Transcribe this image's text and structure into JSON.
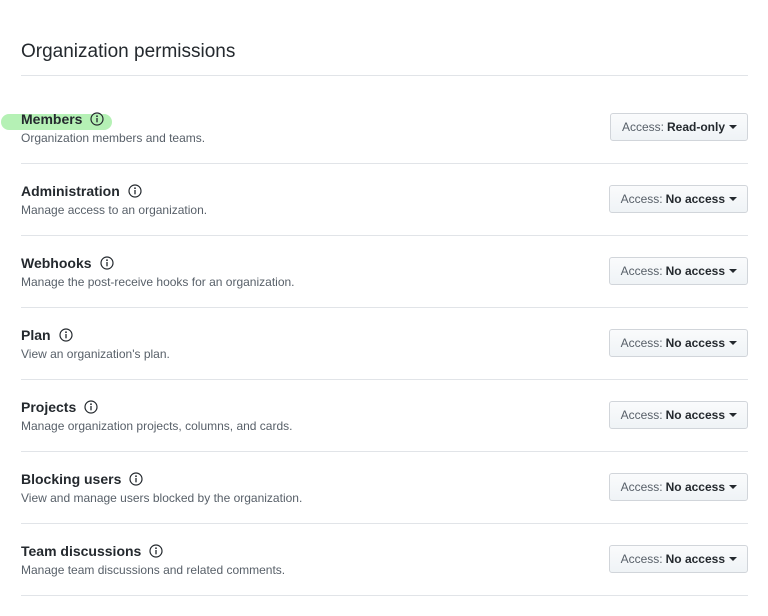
{
  "section": {
    "title": "Organization permissions"
  },
  "access_prefix": "Access:",
  "colors": {
    "highlight": "#78e678",
    "border": "#e1e4e8",
    "text": "#24292e",
    "muted": "#586069"
  },
  "permissions": [
    {
      "name": "Members",
      "description": "Organization members and teams.",
      "access": "Read-only",
      "highlighted": true
    },
    {
      "name": "Administration",
      "description": "Manage access to an organization.",
      "access": "No access"
    },
    {
      "name": "Webhooks",
      "description": "Manage the post-receive hooks for an organization.",
      "access": "No access"
    },
    {
      "name": "Plan",
      "description": "View an organization's plan.",
      "access": "No access"
    },
    {
      "name": "Projects",
      "description": "Manage organization projects, columns, and cards.",
      "access": "No access"
    },
    {
      "name": "Blocking users",
      "description": "View and manage users blocked by the organization.",
      "access": "No access"
    },
    {
      "name": "Team discussions",
      "description": "Manage team discussions and related comments.",
      "access": "No access"
    }
  ]
}
